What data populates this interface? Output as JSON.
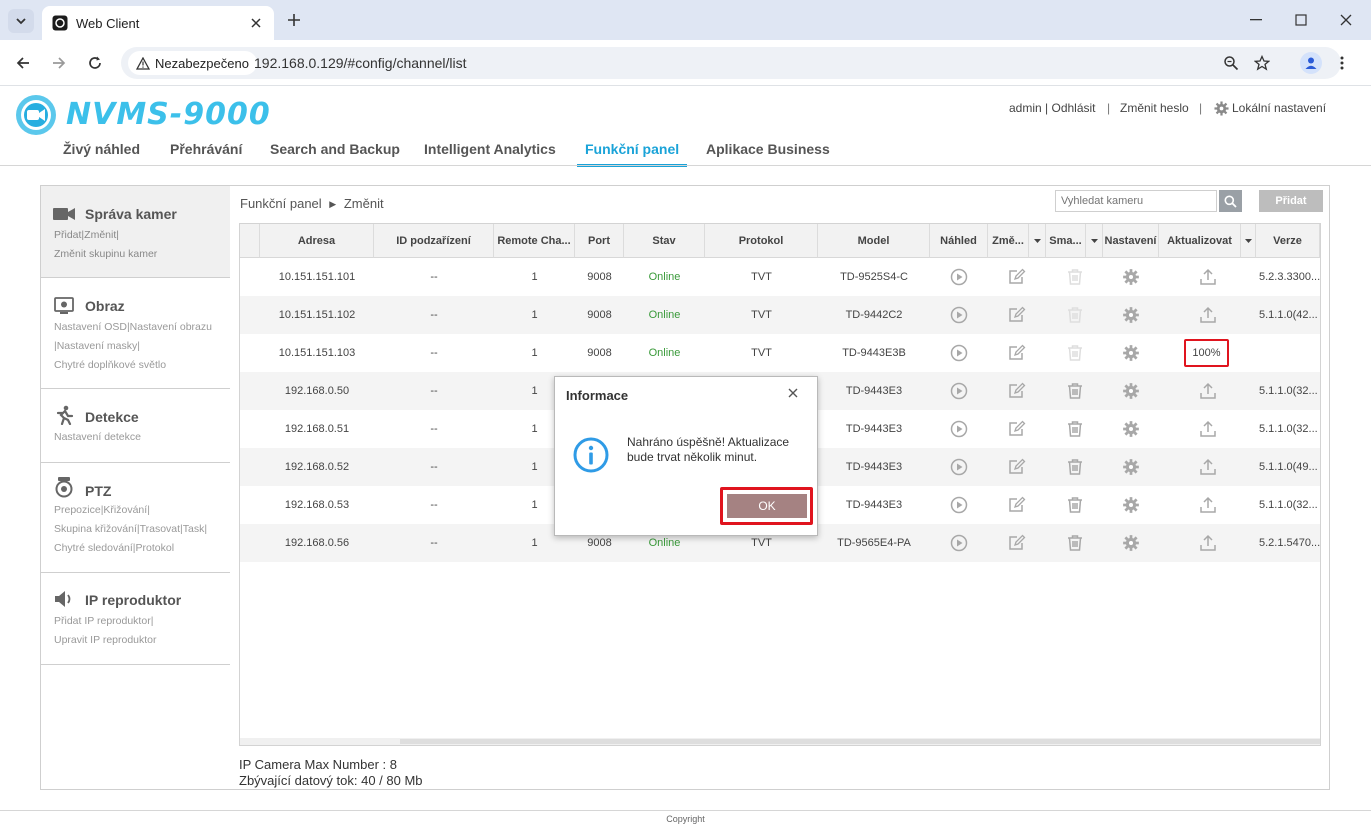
{
  "browser": {
    "tab_title": "Web Client",
    "security_label": "Nezabezpečeno",
    "url": "192.168.0.129/#config/channel/list"
  },
  "app": {
    "logo_text": "NVMS-9000",
    "user_links": {
      "user": "admin",
      "logout": "Odhlásit",
      "change_password": "Změnit heslo",
      "local_settings": "Lokální nastavení"
    },
    "nav": [
      "Živý náhled",
      "Přehrávání",
      "Search and Backup",
      "Intelligent Analytics",
      "Funkční panel",
      "Aplikace Business"
    ],
    "active_nav": "Funkční panel"
  },
  "sidebar": {
    "sections": [
      {
        "title": "Správa kamer",
        "icon": "camera-icon",
        "subs": [
          "Přidat|Změnit|",
          "Změnit skupinu kamer"
        ]
      },
      {
        "title": "Obraz",
        "icon": "image-settings-icon",
        "subs": [
          "Nastavení OSD|Nastavení obrazu",
          "|Nastavení masky|",
          "Chytré doplňkové světlo"
        ]
      },
      {
        "title": "Detekce",
        "icon": "running-person-icon",
        "subs": [
          "Nastavení detekce"
        ]
      },
      {
        "title": "PTZ",
        "icon": "ptz-camera-icon",
        "subs": [
          "Prepozice|Křižování|",
          "Skupina křižování|Trasovat|Task|",
          "Chytré sledování|Protokol"
        ]
      },
      {
        "title": "IP reproduktor",
        "icon": "speaker-icon",
        "subs": [
          "Přidat IP reproduktor|",
          "Upravit IP reproduktor"
        ]
      }
    ]
  },
  "main": {
    "breadcrumb_root": "Funkční panel",
    "breadcrumb_current": "Změnit",
    "search_placeholder": "Vyhledat kameru",
    "add_button": "Přidat",
    "columns": [
      "Adresa",
      "ID podzařízení",
      "Remote Cha...",
      "Port",
      "Stav",
      "Protokol",
      "Model",
      "Náhled",
      "Změ...",
      "Sma...",
      "Nastavení",
      "Aktualizovat",
      "Verze"
    ],
    "rows": [
      {
        "address": "10.151.151.101",
        "sub_id": "--",
        "remote_channel": "1",
        "port": "9008",
        "status": "Online",
        "protocol": "TVT",
        "model": "TD-9525S4-C",
        "version": "5.2.3.3300...",
        "delete_enabled": false,
        "update": "icon"
      },
      {
        "address": "10.151.151.102",
        "sub_id": "--",
        "remote_channel": "1",
        "port": "9008",
        "status": "Online",
        "protocol": "TVT",
        "model": "TD-9442C2",
        "version": "5.1.1.0(42...",
        "delete_enabled": false,
        "update": "icon"
      },
      {
        "address": "10.151.151.103",
        "sub_id": "--",
        "remote_channel": "1",
        "port": "9008",
        "status": "Online",
        "protocol": "TVT",
        "model": "TD-9443E3B",
        "version": "",
        "delete_enabled": false,
        "update": "100%"
      },
      {
        "address": "192.168.0.50",
        "sub_id": "--",
        "remote_channel": "1",
        "port": "",
        "status": "",
        "protocol": "",
        "model": "TD-9443E3",
        "version": "5.1.1.0(32...",
        "delete_enabled": true,
        "update": "icon"
      },
      {
        "address": "192.168.0.51",
        "sub_id": "--",
        "remote_channel": "1",
        "port": "",
        "status": "",
        "protocol": "",
        "model": "TD-9443E3",
        "version": "5.1.1.0(32...",
        "delete_enabled": true,
        "update": "icon"
      },
      {
        "address": "192.168.0.52",
        "sub_id": "--",
        "remote_channel": "1",
        "port": "",
        "status": "",
        "protocol": "",
        "model": "TD-9443E3",
        "version": "5.1.1.0(49...",
        "delete_enabled": true,
        "update": "icon"
      },
      {
        "address": "192.168.0.53",
        "sub_id": "--",
        "remote_channel": "1",
        "port": "",
        "status": "",
        "protocol": "",
        "model": "TD-9443E3",
        "version": "5.1.1.0(32...",
        "delete_enabled": true,
        "update": "icon"
      },
      {
        "address": "192.168.0.56",
        "sub_id": "--",
        "remote_channel": "1",
        "port": "9008",
        "status": "Online",
        "protocol": "TVT",
        "model": "TD-9565E4-PA",
        "version": "5.2.1.5470...",
        "delete_enabled": true,
        "update": "icon"
      }
    ],
    "max_number": "IP Camera Max Number : 8",
    "bandwidth": "Zbývající datový tok: 40 / 80 Mb",
    "copyright": "Copyright"
  },
  "dialog": {
    "title": "Informace",
    "message": "Nahráno úspěšně! Aktualizace bude trvat několik minut.",
    "ok": "OK"
  },
  "colors": {
    "accent": "#1aa3d8",
    "online": "#3a9a3a",
    "highlight": "#e0141e",
    "ok_button": "#a58282"
  }
}
